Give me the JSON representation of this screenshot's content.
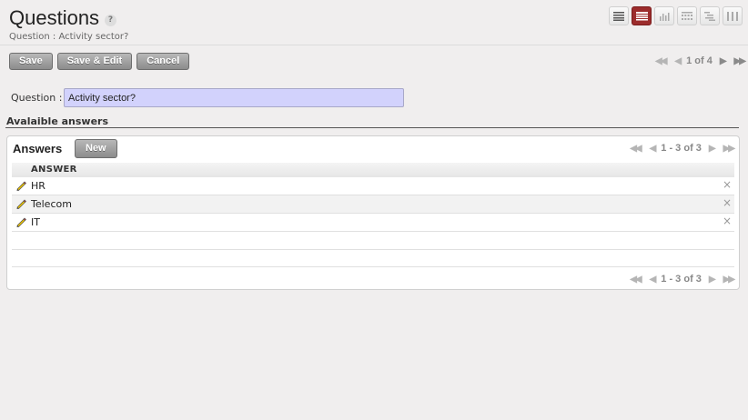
{
  "header": {
    "title": "Questions",
    "help": "?",
    "subtitle": "Question : Activity sector?"
  },
  "view_switcher": [
    "list-view-icon",
    "form-view-icon",
    "graph-view-icon",
    "calendar-view-icon",
    "gantt-view-icon",
    "kanban-view-icon"
  ],
  "toolbar": {
    "save_label": "Save",
    "save_edit_label": "Save & Edit",
    "cancel_label": "Cancel"
  },
  "record_pager": {
    "text": "1 of 4"
  },
  "form": {
    "question_label": "Question :",
    "question_value": "Activity sector?"
  },
  "section": {
    "title": "Avalaible answers"
  },
  "answers": {
    "title": "Answers",
    "new_label": "New",
    "pager_text": "1 - 3 of 3",
    "column": "ANSWER",
    "rows": [
      {
        "value": "HR"
      },
      {
        "value": "Telecom"
      },
      {
        "value": "IT"
      }
    ],
    "delete_glyph": "×"
  },
  "colors": {
    "accent": "#9c2c2c",
    "input_bg": "#d2d2fc",
    "button": "#a0a0a0",
    "background": "#f0eeee"
  }
}
